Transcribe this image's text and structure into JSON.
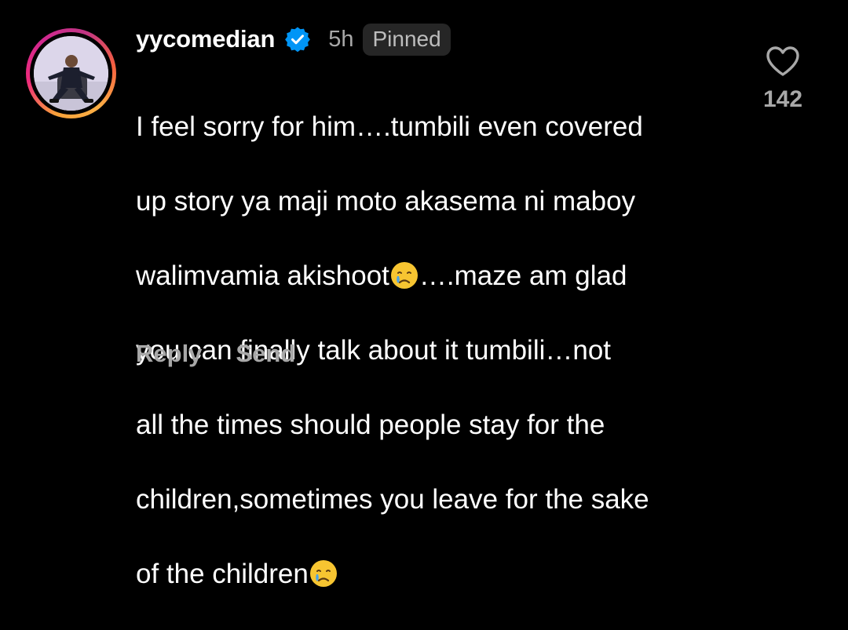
{
  "comment": {
    "username": "yycomedian",
    "verified": true,
    "time_ago": "5h",
    "pinned_label": "Pinned",
    "body_lines": [
      "I feel sorry for him….tumbili even covered",
      "up story ya maji moto akasema ni maboy",
      "walimvamia akishoot",
      "….maze am glad",
      "you can finally talk about it tumbili…not",
      "all the times should people stay for the",
      "children,sometimes you leave for the sake",
      "of the children"
    ],
    "emoji_names": [
      "crying-face-emoji",
      "crying-face-emoji"
    ],
    "like_count": "142",
    "actions": {
      "reply_label": "Reply",
      "send_label": "Send"
    }
  },
  "icons": {
    "verified_badge": "verified-badge-icon",
    "like": "heart-outline-icon"
  },
  "colors": {
    "background": "#000000",
    "primary_text": "#ffffff",
    "secondary_text": "#a8a8a8",
    "pinned_bg": "#262626",
    "verified_blue": "#0095f6",
    "story_ring_start": "#fcaf45",
    "story_ring_end": "#c13584"
  }
}
